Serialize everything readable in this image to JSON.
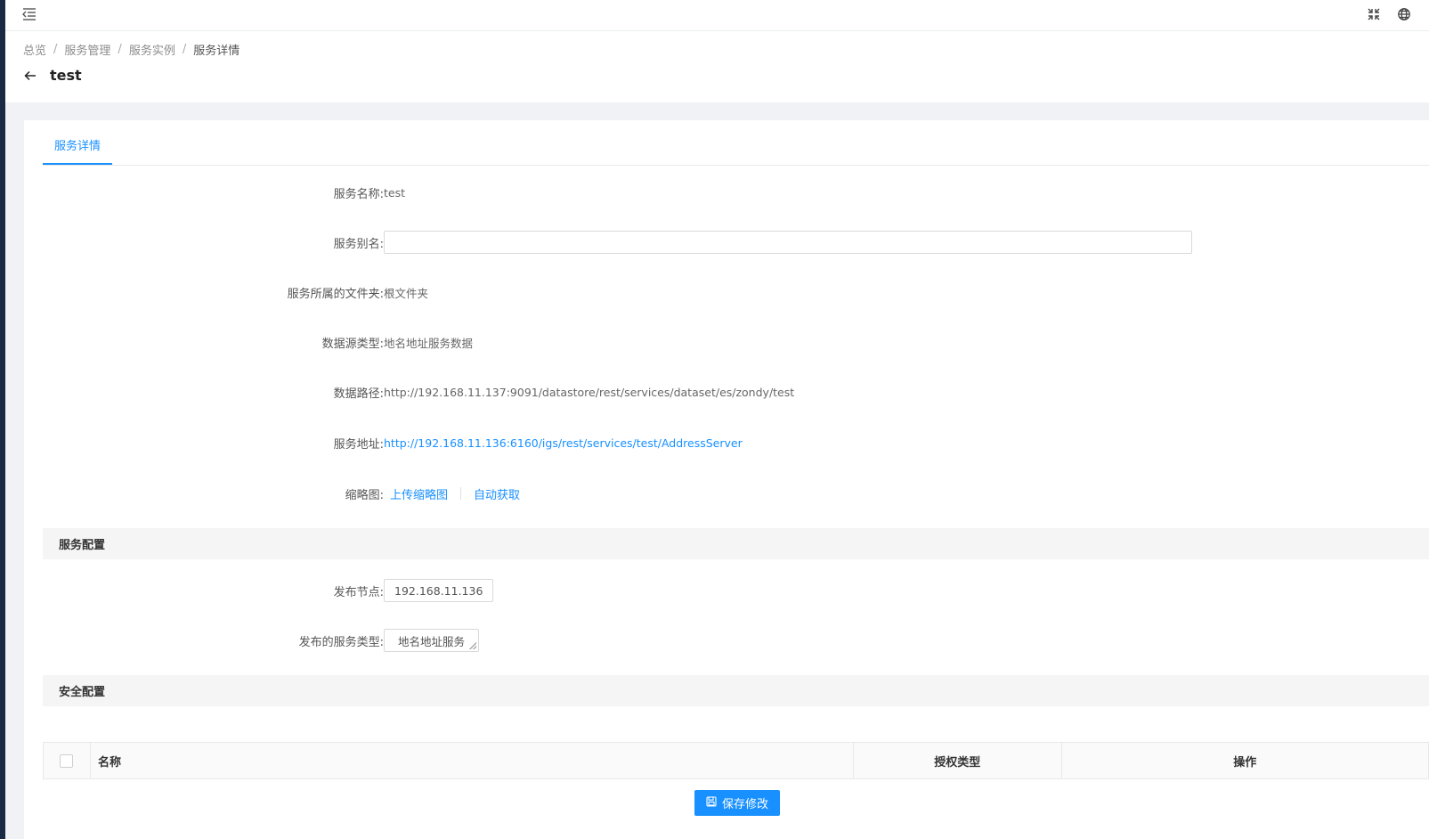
{
  "icons": {
    "menu_toggle": "indent-menu-icon",
    "fullscreen": "compress-icon",
    "language": "globe-icon",
    "back": "arrow-left-icon",
    "save": "save-icon"
  },
  "colors": {
    "primary": "#1890ff",
    "sidebar": "#1b2a44",
    "section_bg": "#f5f5f5"
  },
  "breadcrumb": {
    "items": [
      "总览",
      "服务管理",
      "服务实例"
    ],
    "current": "服务详情",
    "separator": "/"
  },
  "page": {
    "title": "test"
  },
  "tabs": [
    {
      "label": "服务详情",
      "active": true
    }
  ],
  "details": {
    "service_name": {
      "label": "服务名称:",
      "value": "test"
    },
    "service_alias": {
      "label": "服务别名:",
      "value": "",
      "placeholder": ""
    },
    "folder": {
      "label": "服务所属的文件夹:",
      "value": "根文件夹"
    },
    "datasource_type": {
      "label": "数据源类型:",
      "value": "地名地址服务数据"
    },
    "data_path": {
      "label": "数据路径:",
      "value": "http://192.168.11.137:9091/datastore/rest/services/dataset/es/zondy/test"
    },
    "service_url": {
      "label": "服务地址:",
      "value": "http://192.168.11.136:6160/igs/rest/services/test/AddressServer"
    },
    "thumbnail": {
      "label": "缩略图:",
      "upload": "上传缩略图",
      "auto": "自动获取"
    }
  },
  "service_config": {
    "title": "服务配置",
    "node": {
      "label": "发布节点:",
      "value": "192.168.11.136"
    },
    "service_type": {
      "label": "发布的服务类型:",
      "value": "地名地址服务"
    }
  },
  "security_config": {
    "title": "安全配置",
    "columns": [
      "名称",
      "授权类型",
      "操作"
    ]
  },
  "actions": {
    "save_label": "保存修改"
  }
}
